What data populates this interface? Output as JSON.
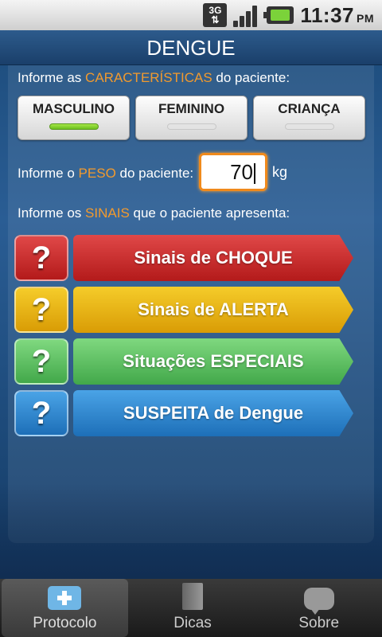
{
  "status": {
    "network": "3G",
    "time": "11:37",
    "ampm": "PM"
  },
  "title": "DENGUE",
  "characteristics": {
    "prefix": "Informe as ",
    "highlight": "CARACTERÍSTICAS",
    "suffix": " do paciente:",
    "options": [
      {
        "label": "MASCULINO",
        "selected": true
      },
      {
        "label": "FEMININO",
        "selected": false
      },
      {
        "label": "CRIANÇA",
        "selected": false
      }
    ]
  },
  "weight": {
    "prefix": "Informe o ",
    "highlight": "PESO",
    "suffix": " do paciente:",
    "value": "70",
    "unit": "kg"
  },
  "signs": {
    "prefix": "Informe os ",
    "highlight": "SINAIS",
    "suffix": " que o paciente apresenta:",
    "items": [
      {
        "help": "?",
        "label": "Sinais de CHOQUE",
        "color": "#c62828"
      },
      {
        "help": "?",
        "label": "Sinais de ALERTA",
        "color": "#e6a90c"
      },
      {
        "help": "?",
        "label": "Situações ESPECIAIS",
        "color": "#4caf50"
      },
      {
        "help": "?",
        "label": "SUSPEITA de Dengue",
        "color": "#1e88e5"
      }
    ]
  },
  "tabs": [
    {
      "label": "Protocolo",
      "icon": "medkit-icon",
      "active": true
    },
    {
      "label": "Dicas",
      "icon": "book-icon",
      "active": false
    },
    {
      "label": "Sobre",
      "icon": "speech-bubble-icon",
      "active": false
    }
  ]
}
